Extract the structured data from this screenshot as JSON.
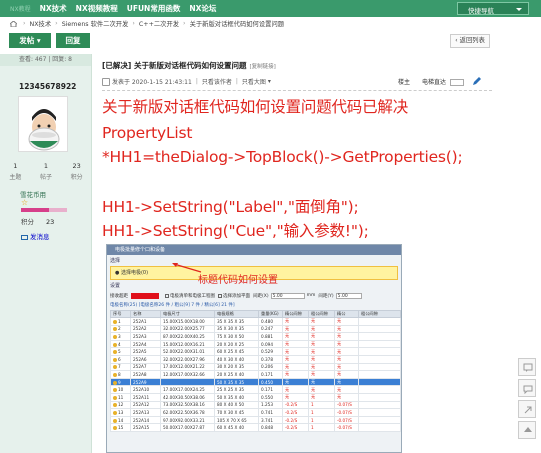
{
  "topnav": {
    "items": [
      "NX技术",
      "NX视频教程",
      "UFUN常用函数",
      "NX论坛"
    ],
    "dim_items": [
      "NX教程"
    ],
    "quick_nav": "快捷导航"
  },
  "breadcrumb": [
    "NX技术",
    "Siemens 软件二次开发",
    "C++二次开发",
    "关于新版对话框代码如何设置问题"
  ],
  "buttons": {
    "post": "发帖",
    "reply": "回复",
    "back": "返回列表"
  },
  "author": {
    "stats_bar": "查看: 467 | 回复: 8",
    "name": "12345678922",
    "topics": "1",
    "topics_label": "主题",
    "posts": "1",
    "posts_label": "帖子",
    "points": "23",
    "points_label": "积分",
    "rank": "雪花币用",
    "level_progress": 0.6,
    "jifen_label": "积分",
    "jifen_value": "23",
    "message": "发消息"
  },
  "post": {
    "title": "[已解决] 关于新版对话框代码如何设置问题",
    "copy_link": "[复制链接]",
    "posted": "发表于 2020-1-15 21:43:11",
    "author_only": "只看该作者",
    "big_image": "只看大图",
    "floor": "楼主",
    "jump": "电梯直达",
    "lines": [
      "关于新版对话框代码如何设置问题代码已解决",
      "PropertyList",
      "*HH1=theDialog->TopBlock()->GetProperties();",
      "HH1->SetString(\"Label\",\"面倒角\");",
      "HH1->SetString(\"Cue\",\"输入参数!\");"
    ],
    "annotation": "标题代码如何设置"
  },
  "screenshot": {
    "titlebar": "电极批量修个口和设备",
    "sec1": "选择",
    "yellow_text": "● 选择电极(0)",
    "sec2": "设置",
    "row1_label": "接收超距",
    "row1_opt1": "电极清单和电极工程图",
    "row1_opt2": "选择添加平面",
    "row1_val_label": "间距(X)",
    "row1_val1": "5.00",
    "row1_unit": "mm",
    "row1_val2_label": "间距(Y)",
    "row1_val2": "5.00",
    "tabs": "电极名称(25) [电极名称26 件 / 粗公[9] 7 件 / 精公[6] 21 件]",
    "headers": [
      "序号",
      "名称",
      "电极尺寸",
      "电极规格",
      "重量(KG)",
      "精公间隙",
      "粗公间隙",
      "精公",
      "粗公间隙"
    ],
    "rows": [
      [
        "1",
        "252A1",
        "15.00X15.00X18.00",
        "35 X 35 X 35",
        "0.480",
        "无",
        "无",
        "无"
      ],
      [
        "2",
        "252A2",
        "32.00X22.00X25.77",
        "35 X 30 X 35",
        "0.247",
        "无",
        "无",
        "无"
      ],
      [
        "3",
        "252A3",
        "87.00X22.00X40.25",
        "75 X 30 X 50",
        "0.881",
        "无",
        "无",
        "无"
      ],
      [
        "4",
        "252A4",
        "15.00X12.00X16.21",
        "20 X 20 X 25",
        "0.094",
        "无",
        "无",
        "无"
      ],
      [
        "5",
        "252A5",
        "52.00X22.00X31.01",
        "60 X 25 X 45",
        "0.529",
        "无",
        "无",
        "无"
      ],
      [
        "6",
        "252A6",
        "32.00X22.00X27.96",
        "40 X 30 X 40",
        "0.378",
        "无",
        "无",
        "无"
      ],
      [
        "7",
        "252A7",
        "17.00X12.00X21.22",
        "30 X 20 X 35",
        "0.206",
        "无",
        "无",
        "无"
      ],
      [
        "8",
        "252A8",
        "12.00X17.00X32.66",
        "20 X 25 X 40",
        "0.171",
        "无",
        "无",
        "无"
      ],
      [
        "9",
        "252A9",
        "",
        "50 X 35 X 35",
        "0.450",
        "无",
        "无",
        "无"
      ],
      [
        "10",
        "252A10",
        "17.00X17.00X24.25",
        "25 X 25 X 35",
        "0.171",
        "无",
        "无",
        "无"
      ],
      [
        "11",
        "252A11",
        "42.00X30.50X38.06",
        "50 X 35 X 40",
        "0.550",
        "无",
        "无",
        "无"
      ],
      [
        "12",
        "252A12",
        "73.00X32.50X38.16",
        "80 X 40 X 50",
        "1.253",
        "-0.2/S",
        "1",
        "-0.07/S"
      ],
      [
        "13",
        "252A13",
        "62.00X22.50X36.78",
        "70 X 30 X 45",
        "0.741",
        "-0.2/S",
        "1",
        "-0.07/S"
      ],
      [
        "14",
        "252A14",
        "97.00X92.00X33.21",
        "105 X 70 X 65",
        "3.741",
        "-0.2/S",
        "1",
        "-0.07/S"
      ],
      [
        "15",
        "252A15",
        "50.00X17.00X27.87",
        "60 X 45 X 40",
        "0.848",
        "-0.2/S",
        "1",
        "-0.07/S"
      ]
    ],
    "selected_row": 8
  }
}
